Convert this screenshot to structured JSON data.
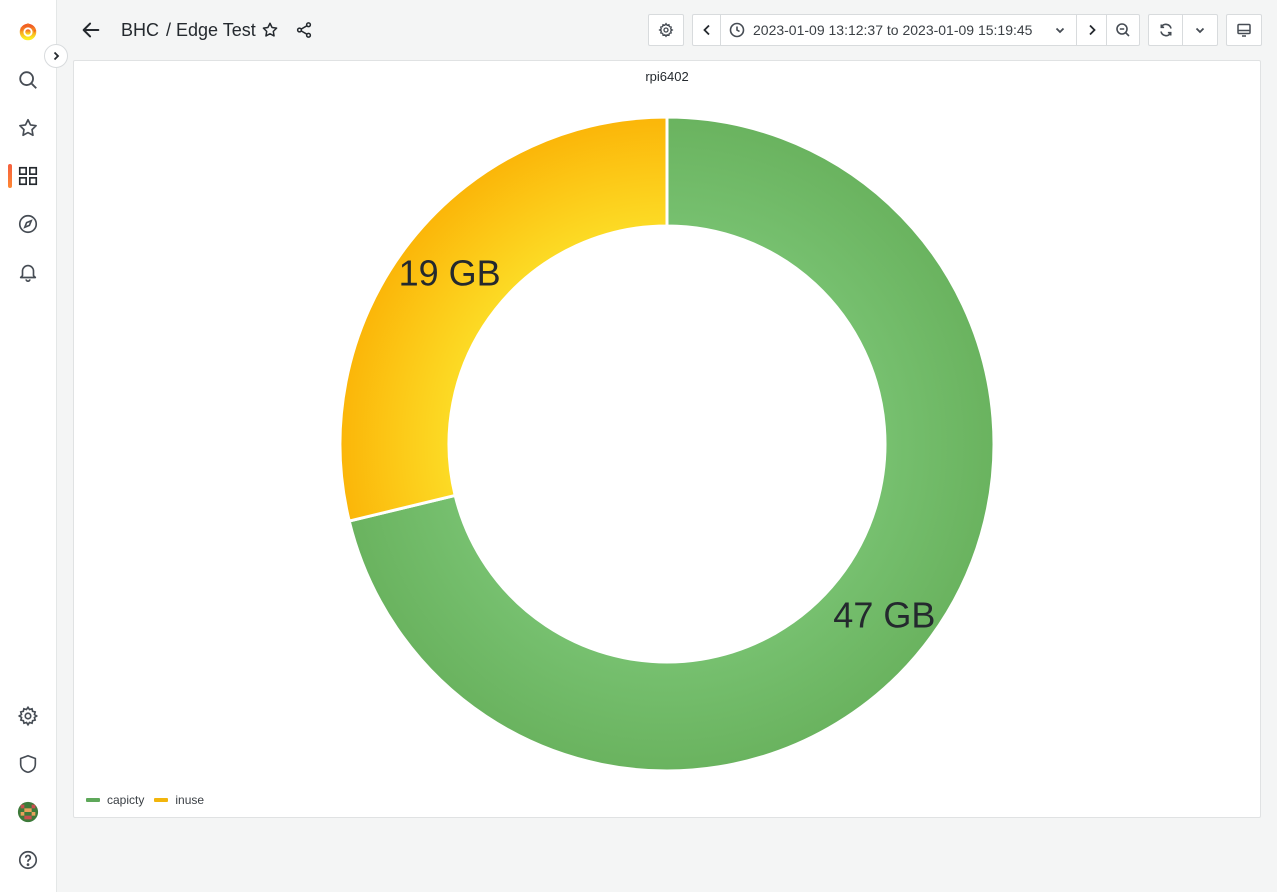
{
  "breadcrumb": {
    "folder": "BHC",
    "separator": "/",
    "dashboard": "Edge Test"
  },
  "time_range": {
    "text": "2023-01-09 13:12:37 to 2023-01-09 15:19:45"
  },
  "sidebar": {
    "items": [
      "grafana-logo",
      "search",
      "starred",
      "dashboards",
      "explore",
      "alerting"
    ],
    "active": "dashboards",
    "bottom": [
      "configuration",
      "server-admin",
      "profile",
      "help"
    ]
  },
  "panel": {
    "title": "rpi6402"
  },
  "chart_data": {
    "type": "pie",
    "title": "rpi6402",
    "donut": true,
    "slices": [
      {
        "name": "capicty",
        "value": 47,
        "label": "47 GB",
        "color": "#73bf69"
      },
      {
        "name": "inuse",
        "value": 19,
        "label": "19 GB",
        "color": "#fade2a"
      }
    ],
    "legend": {
      "placement": "bottom-left"
    }
  }
}
